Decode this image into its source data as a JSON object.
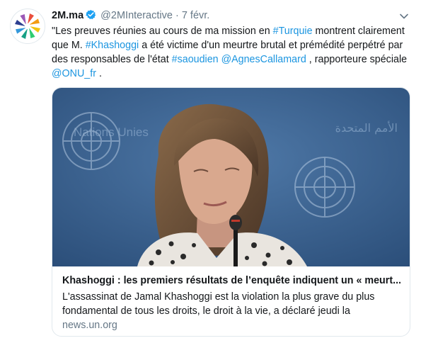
{
  "tweet": {
    "author_name": "2M.ma",
    "handle": "@2MInteractive",
    "separator": "·",
    "timestamp": "7 févr.",
    "text_parts": [
      {
        "text": "\"Les preuves réunies au  cours de ma mission en ",
        "link": false
      },
      {
        "text": "#Turquie",
        "link": true
      },
      {
        "text": " montrent clairement que M. ",
        "link": false
      },
      {
        "text": "#Khashoggi",
        "link": true
      },
      {
        "text": " a été victime d'un meurtre brutal et prémédité perpétré par des responsables de l'état ",
        "link": false
      },
      {
        "text": "#saoudien",
        "link": true
      },
      {
        "text": " ",
        "link": false
      },
      {
        "text": "@AgnesCallamard",
        "link": true
      },
      {
        "text": " , rapporteure spéciale ",
        "link": false
      },
      {
        "text": "@ONU_fr",
        "link": true
      },
      {
        "text": " .",
        "link": false
      }
    ],
    "link_color": "#1b95e0",
    "verified_color": "#1da1f2"
  },
  "card": {
    "title": "Khashoggi : les premiers résultats de l’enquête indiquent un « meurt...",
    "description": "L'assassinat de Jamal Khashoggi est la violation la plus grave du plus fondamental de tous les droits, le droit à la vie, a déclaré jeudi la",
    "domain": "news.un.org",
    "photo_text": {
      "wall_fr": "Nations Unies",
      "wall_ar": "الأمم المتحدة"
    }
  },
  "icons": {
    "avatar": "2m-logo-icon",
    "verified": "verified-badge-icon",
    "caret": "chevron-down-icon"
  }
}
